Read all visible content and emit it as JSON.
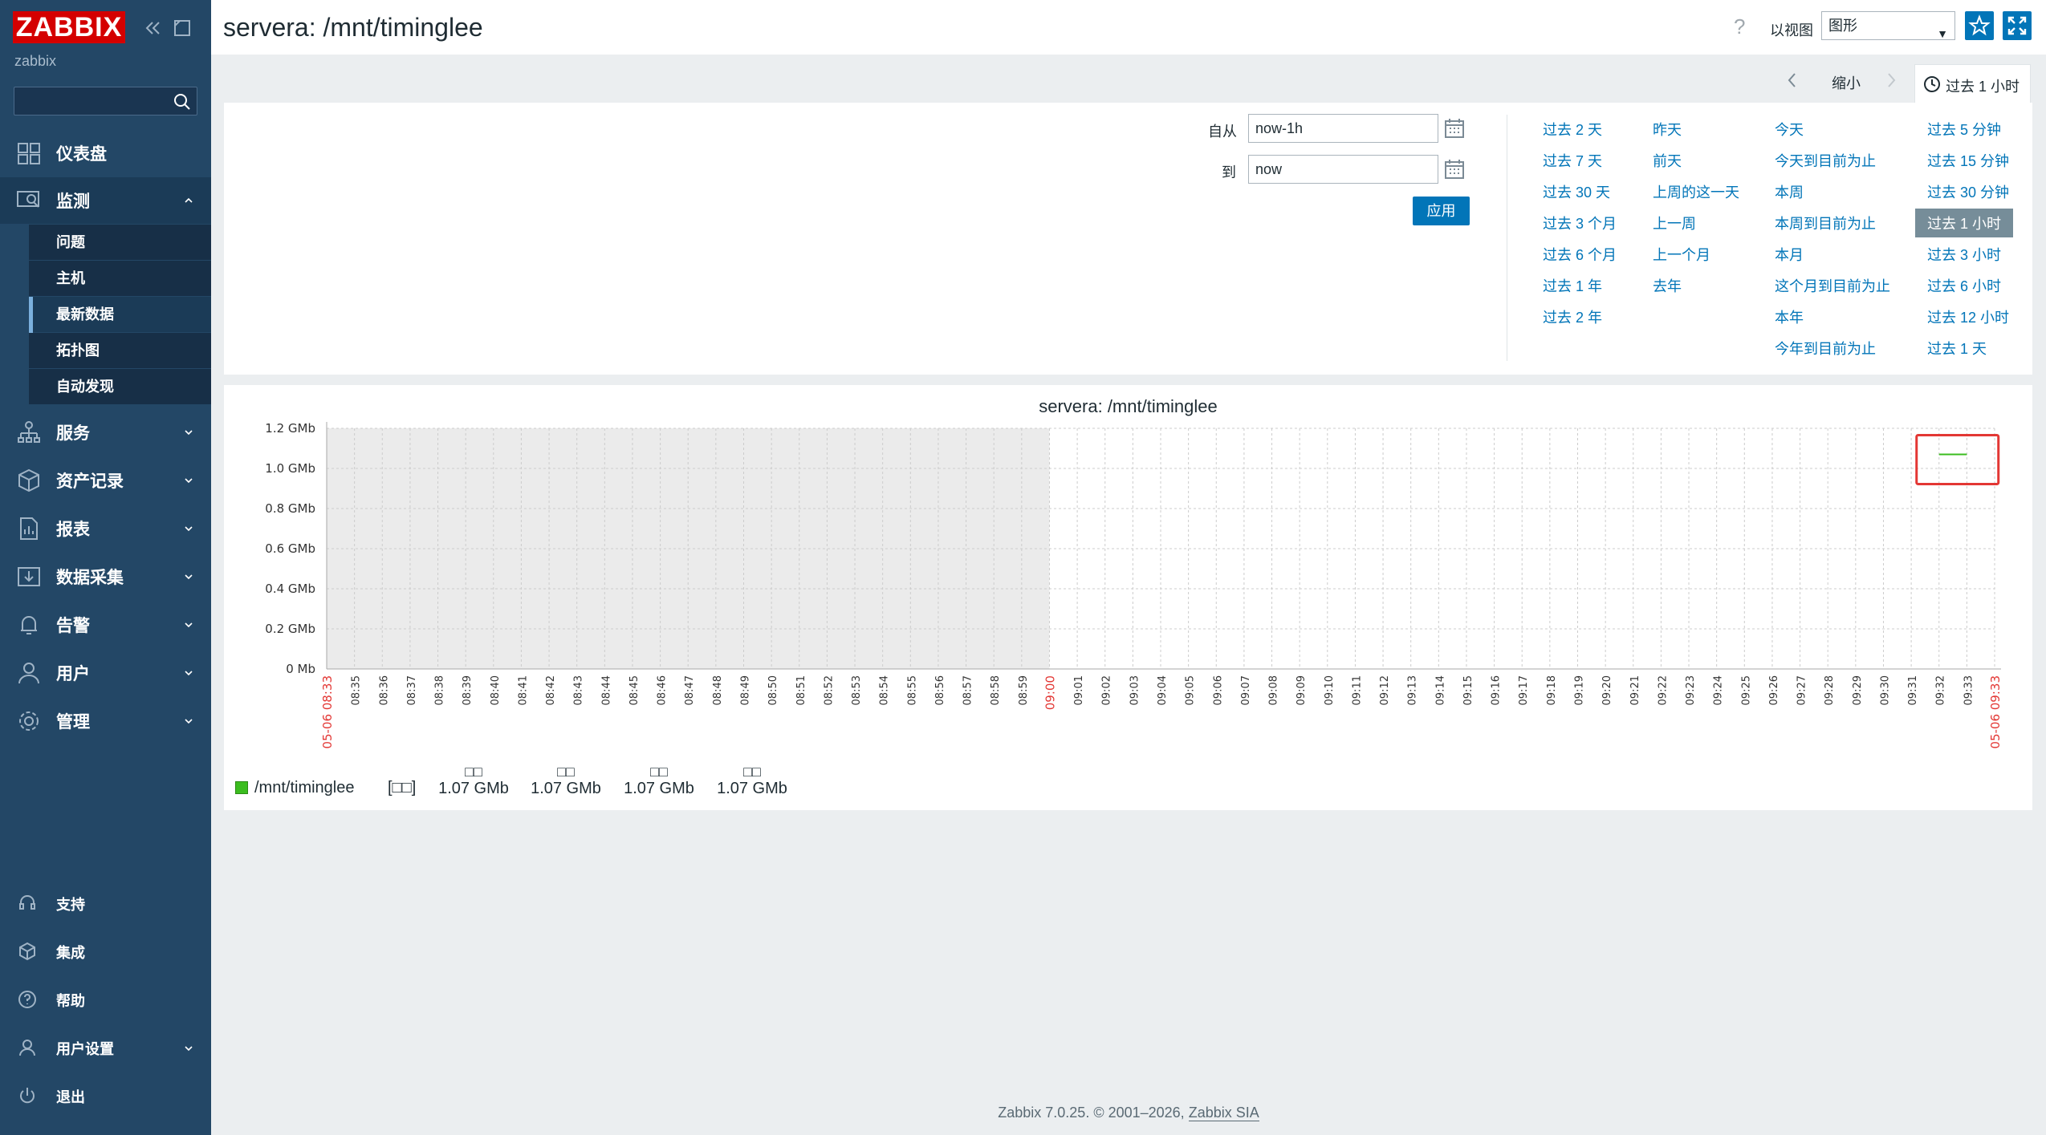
{
  "sidebar": {
    "logo": "ZABBIX",
    "server_name": "zabbix",
    "search_placeholder": "",
    "nav": [
      {
        "label": "仪表盘",
        "icon": "dashboard-icon"
      },
      {
        "label": "监测",
        "icon": "monitoring-icon"
      },
      {
        "label": "服务",
        "icon": "services-icon"
      },
      {
        "label": "资产记录",
        "icon": "inventory-icon"
      },
      {
        "label": "报表",
        "icon": "reports-icon"
      },
      {
        "label": "数据采集",
        "icon": "data-collection-icon"
      },
      {
        "label": "告警",
        "icon": "alerts-icon"
      },
      {
        "label": "用户",
        "icon": "users-icon"
      },
      {
        "label": "管理",
        "icon": "administration-icon"
      }
    ],
    "submenu": [
      "问题",
      "主机",
      "最新数据",
      "拓扑图",
      "自动发现"
    ],
    "footer": [
      {
        "label": "支持",
        "icon": "support-icon"
      },
      {
        "label": "集成",
        "icon": "integrations-icon"
      },
      {
        "label": "帮助",
        "icon": "help-icon"
      },
      {
        "label": "用户设置",
        "icon": "user-settings-icon"
      },
      {
        "label": "退出",
        "icon": "sign-out-icon"
      }
    ]
  },
  "header": {
    "title": "servera: /mnt/timinglee",
    "help": "?",
    "view_as_label": "以视图",
    "view_as_value": "图形"
  },
  "timebar": {
    "zoom_out": "缩小",
    "tab_label": "过去 1 小时"
  },
  "filter": {
    "from_label": "自从",
    "from_value": "now-1h",
    "to_label": "到",
    "to_value": "now",
    "apply": "应用",
    "ranges": [
      [
        "过去 2 天",
        "过去 7 天",
        "过去 30 天",
        "过去 3 个月",
        "过去 6 个月",
        "过去 1 年",
        "过去 2 年"
      ],
      [
        "昨天",
        "前天",
        "上周的这一天",
        "上一周",
        "上一个月",
        "去年"
      ],
      [
        "今天",
        "今天到目前为止",
        "本周",
        "本周到目前为止",
        "本月",
        "这个月到目前为止",
        "本年",
        "今年到目前为止"
      ],
      [
        "过去 5 分钟",
        "过去 15 分钟",
        "过去 30 分钟",
        "过去 1 小时",
        "过去 3 小时",
        "过去 6 小时",
        "过去 12 小时",
        "过去 1 天"
      ]
    ],
    "active_range": "过去 1 小时"
  },
  "graph": {
    "legend_name": "/mnt/timinglee",
    "legend_type": "[□□]",
    "legend_headers": [
      "□□",
      "□□",
      "□□",
      "□□"
    ],
    "legend_values": [
      "1.07 GMb",
      "1.07 GMb",
      "1.07 GMb",
      "1.07 GMb"
    ]
  },
  "chart_data": {
    "type": "line",
    "title": "servera: /mnt/timinglee",
    "y_ticks": [
      "0 Mb",
      "0.2 GMb",
      "0.4 GMb",
      "0.6 GMb",
      "0.8 GMb",
      "1.0 GMb",
      "1.2 GMb"
    ],
    "ylim": [
      0,
      1.2
    ],
    "x_ticks": [
      "05-06 08:33",
      "08:35",
      "08:36",
      "08:37",
      "08:38",
      "08:39",
      "08:40",
      "08:41",
      "08:42",
      "08:43",
      "08:44",
      "08:45",
      "08:46",
      "08:47",
      "08:48",
      "08:49",
      "08:50",
      "08:51",
      "08:52",
      "08:53",
      "08:54",
      "08:55",
      "08:56",
      "08:57",
      "08:58",
      "08:59",
      "09:00",
      "09:01",
      "09:02",
      "09:03",
      "09:04",
      "09:05",
      "09:06",
      "09:07",
      "09:08",
      "09:09",
      "09:10",
      "09:11",
      "09:12",
      "09:13",
      "09:14",
      "09:15",
      "09:16",
      "09:17",
      "09:18",
      "09:19",
      "09:20",
      "09:21",
      "09:22",
      "09:23",
      "09:24",
      "09:25",
      "09:26",
      "09:27",
      "09:28",
      "09:29",
      "09:30",
      "09:31",
      "09:32",
      "09:33",
      "05-06 09:33"
    ],
    "red_ticks": [
      "05-06 08:33",
      "09:00",
      "05-06 09:33"
    ],
    "no_data_until": "08:59",
    "series": [
      {
        "name": "/mnt/timinglee",
        "color": "#3bbd1f",
        "x": [
          "09:32",
          "09:33"
        ],
        "values": [
          1.07,
          1.07
        ]
      }
    ],
    "grid": true
  },
  "footer": {
    "text": "Zabbix 7.0.25. © 2001–2026,",
    "link": "Zabbix SIA"
  }
}
